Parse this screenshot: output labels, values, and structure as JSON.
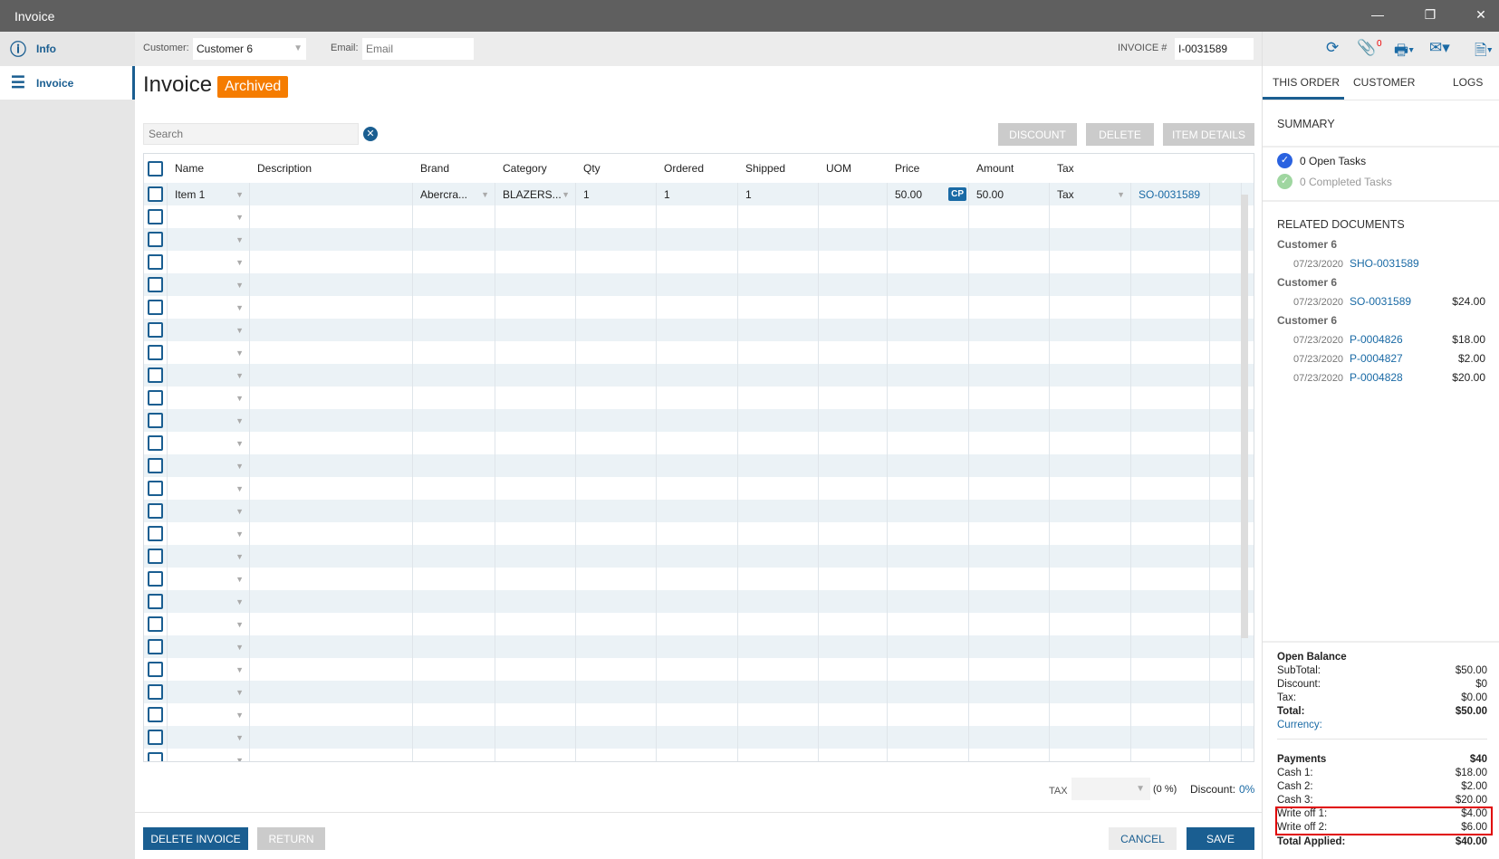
{
  "window": {
    "title": "Invoice",
    "controls": [
      "—",
      "❐",
      "✕"
    ]
  },
  "sidebar": {
    "items": [
      {
        "label": "Info",
        "icon": "info-icon"
      },
      {
        "label": "Invoice",
        "icon": "list-icon"
      }
    ]
  },
  "topbar": {
    "customer_label": "Customer:",
    "customer_value": "Customer 6",
    "email_label": "Email:",
    "email_placeholder": "Email",
    "invoice_label": "INVOICE #",
    "invoice_value": "I-0031589",
    "attachment_count": "0"
  },
  "header": {
    "title": "Invoice",
    "status": "Archived"
  },
  "search": {
    "placeholder": "Search"
  },
  "toolbar": {
    "discount": "DISCOUNT",
    "delete": "DELETE",
    "item_details": "ITEM DETAILS"
  },
  "table": {
    "columns": [
      "Name",
      "Description",
      "Brand",
      "Category",
      "Qty",
      "Ordered",
      "Shipped",
      "UOM",
      "Price",
      "Amount",
      "Tax"
    ],
    "rows": [
      {
        "name": "Item 1",
        "description": "",
        "brand": "Abercra...",
        "category": "BLAZERS...",
        "qty": "1",
        "ordered": "1",
        "shipped": "1",
        "uom": "",
        "price": "50.00",
        "cp": "CP",
        "amount": "50.00",
        "tax": "Tax",
        "link": "SO-0031589"
      }
    ],
    "empty_rows": 25
  },
  "footer": {
    "tax_label": "TAX",
    "tax_pct": "(0 %)",
    "discount_label": "Discount:",
    "discount_value": "0%",
    "delete_invoice": "DELETE INVOICE",
    "return": "RETURN",
    "cancel": "CANCEL",
    "save": "SAVE"
  },
  "right": {
    "tabs": [
      "THIS ORDER",
      "CUSTOMER",
      "LOGS"
    ],
    "summary_title": "SUMMARY",
    "open_tasks": "0 Open Tasks",
    "completed_tasks": "0 Completed Tasks",
    "related_title": "RELATED DOCUMENTS",
    "related": [
      {
        "customer": "Customer 6",
        "docs": [
          {
            "date": "07/23/2020",
            "doc": "SHO-0031589",
            "amount": ""
          }
        ]
      },
      {
        "customer": "Customer 6",
        "docs": [
          {
            "date": "07/23/2020",
            "doc": "SO-0031589",
            "amount": "$24.00"
          }
        ]
      },
      {
        "customer": "Customer 6",
        "docs": [
          {
            "date": "07/23/2020",
            "doc": "P-0004826",
            "amount": "$18.00"
          },
          {
            "date": "07/23/2020",
            "doc": "P-0004827",
            "amount": "$2.00"
          },
          {
            "date": "07/23/2020",
            "doc": "P-0004828",
            "amount": "$20.00"
          }
        ]
      }
    ],
    "balance": {
      "title": "Open Balance",
      "subtotal_label": "SubTotal:",
      "subtotal": "$50.00",
      "discount_label": "Discount:",
      "discount": "$0",
      "tax_label": "Tax:",
      "tax": "$0.00",
      "total_label": "Total:",
      "total": "$50.00",
      "currency_label": "Currency:"
    },
    "payments": {
      "title": "Payments",
      "total": "$40",
      "items": [
        {
          "label": "Cash 1:",
          "amount": "$18.00"
        },
        {
          "label": "Cash 2:",
          "amount": "$2.00"
        },
        {
          "label": "Cash 3:",
          "amount": "$20.00"
        },
        {
          "label": "Write off 1:",
          "amount": "$4.00"
        },
        {
          "label": "Write off 2:",
          "amount": "$6.00"
        }
      ],
      "applied_label": "Total Applied:",
      "applied": "$40.00"
    }
  },
  "colors": {
    "accent": "#1a5e91",
    "badge": "#f57c00",
    "highlight": "#e00000"
  }
}
